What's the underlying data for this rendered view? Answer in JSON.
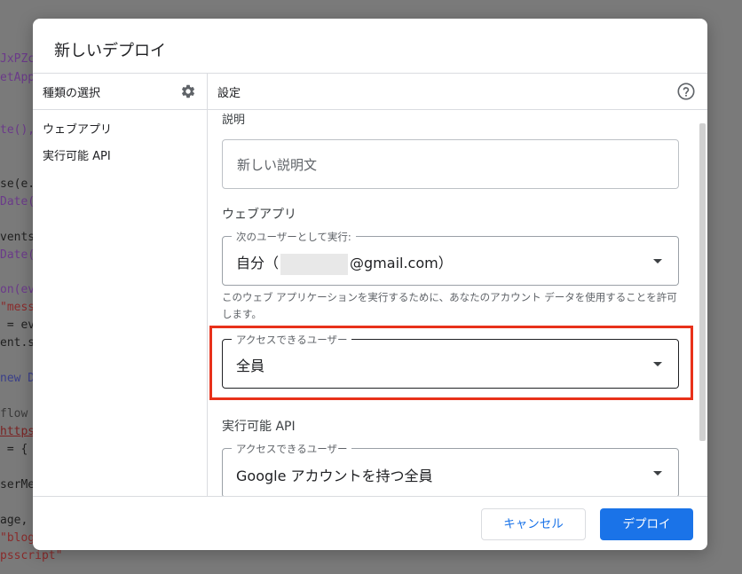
{
  "background_code": [
    {
      "text": "JxPZc",
      "color": "purple"
    },
    {
      "text": "etApp",
      "color": "purple"
    },
    {
      "text": "te(),",
      "color": "purple"
    },
    {
      "text": "se(e.",
      "color": "dark"
    },
    {
      "text": "Date(",
      "color": "purple"
    },
    {
      "text": "vents",
      "color": "dark"
    },
    {
      "text": "Date(",
      "color": "purple"
    },
    {
      "text": "on(ev",
      "color": "purple"
    },
    {
      "text": "\"mess",
      "color": "red"
    },
    {
      "text": " = ev",
      "color": "dark"
    },
    {
      "text": "ent.s",
      "color": "dark"
    },
    {
      "text": "new D",
      "color": "blue"
    },
    {
      "text": "flow ",
      "color": "gray"
    },
    {
      "text": "https",
      "color": "link"
    },
    {
      "text": " = {",
      "color": "dark"
    },
    {
      "text": "serMe",
      "color": "dark"
    },
    {
      "text": "age, ",
      "color": "dark"
    },
    {
      "text": "\"blog",
      "color": "red"
    },
    {
      "text": "psscript\"",
      "color": "red"
    }
  ],
  "dialog": {
    "title": "新しいデプロイ",
    "left_panel": {
      "header": "種類の選択",
      "items": [
        "ウェブアプリ",
        "実行可能 API"
      ]
    },
    "right_panel": {
      "header": "設定",
      "description_label": "説明",
      "description_placeholder": "新しい説明文",
      "webapp_section": "ウェブアプリ",
      "execute_as_label": "次のユーザーとして実行:",
      "execute_as_prefix": "自分（",
      "execute_as_suffix": "@gmail.com）",
      "execute_as_help": "このウェブ アプリケーションを実行するために、あなたのアカウント データを使用することを許可します。",
      "access_label": "アクセスできるユーザー",
      "access_value": "全員",
      "api_section": "実行可能 API",
      "api_access_label": "アクセスできるユーザー",
      "api_access_value": "Google アカウントを持つ全員"
    },
    "buttons": {
      "cancel": "キャンセル",
      "deploy": "デプロイ"
    }
  },
  "colors": {
    "primary": "#1a73e8",
    "highlight": "#e8311a"
  }
}
